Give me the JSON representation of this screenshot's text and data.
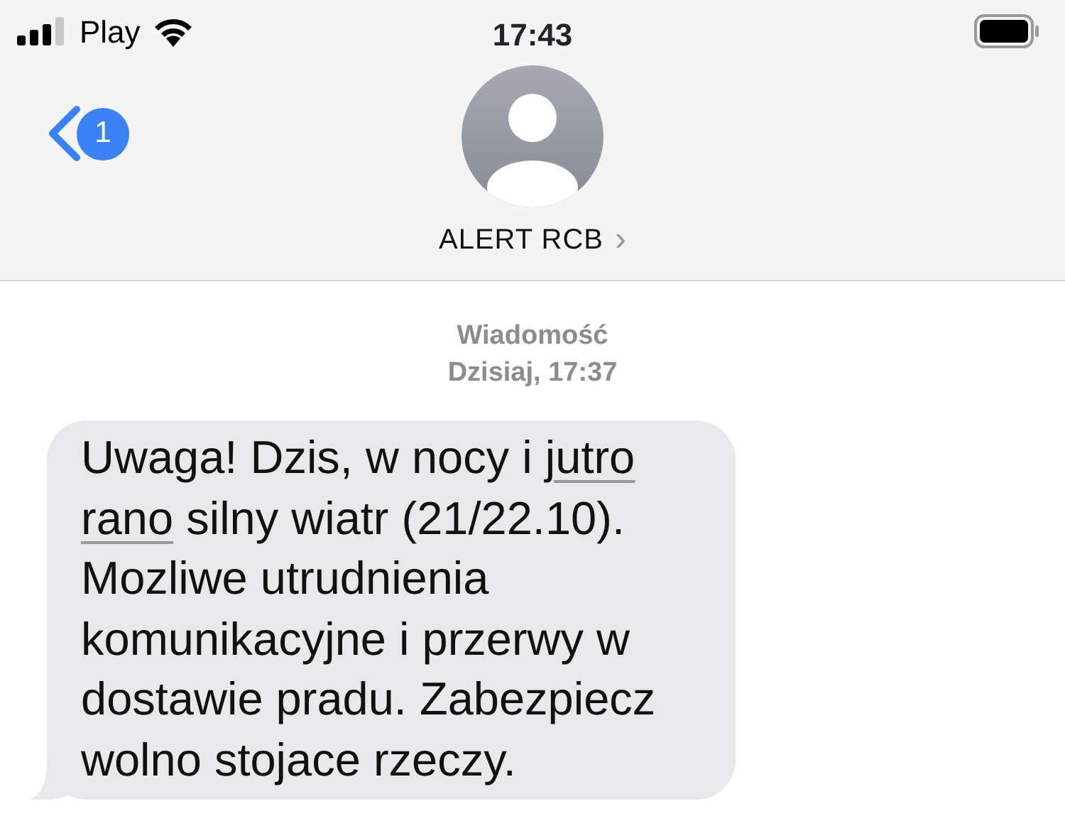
{
  "status_bar": {
    "carrier": "Play",
    "time": "17:43"
  },
  "header": {
    "back_badge": "1",
    "contact": "ALERT RCB",
    "contact_chevron": "›"
  },
  "thread": {
    "service": "Wiadomość",
    "timestamp": "Dzisiaj, 17:37",
    "messages": [
      {
        "parts": [
          {
            "kind": "plain",
            "text": "Uwaga! Dzis, w nocy i "
          },
          {
            "kind": "link",
            "text": "jutro"
          },
          {
            "kind": "link",
            "text": "rano",
            "line_break_before": true
          },
          {
            "kind": "plain",
            "text": " silny wiatr (21/22.10). Mozliwe utrudnienia komunikacyjne i przerwy w dostawie pradu. Zabezpiecz wolno stojace rzeczy."
          }
        ]
      }
    ]
  }
}
